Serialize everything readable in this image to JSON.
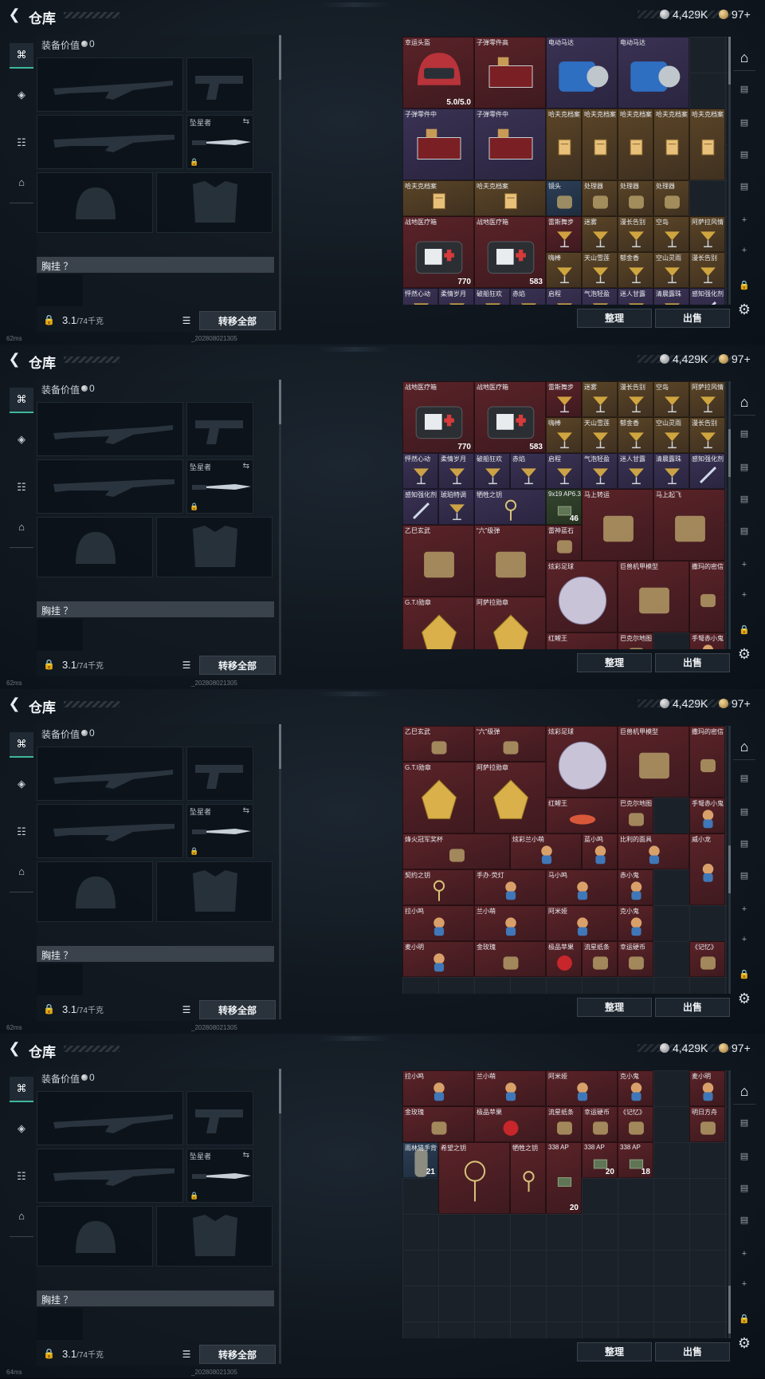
{
  "header": {
    "title": "仓库",
    "currency_silver": "4,429K",
    "currency_gold": "97+"
  },
  "equipment": {
    "value_label": "装备价值",
    "value": "0",
    "melee_name": "坠星者",
    "chest_label": "胸挂 ？",
    "weight_value": "3.1",
    "weight_max": "/74千克",
    "transfer_all": "转移全部"
  },
  "inventory": {
    "sort_button": "整理",
    "sell_button": "出售"
  },
  "right_rail": {
    "tabs": [
      "warehouse-icon",
      "crate-icon",
      "bag-icon",
      "bag-icon",
      "bag-icon",
      "plus-icon",
      "plus-icon",
      "lock-icon",
      "gear-icon"
    ]
  },
  "status": {
    "ping": [
      "62ms",
      "62ms",
      "62ms",
      "64ms"
    ],
    "build": "_202808021305"
  },
  "frames": [
    {
      "items": [
        {
          "name": "幸运头盔",
          "count": "5.0/5.0",
          "rarity": "red",
          "icon": "helmet-icon"
        },
        {
          "name": "子弹零件高",
          "count": "",
          "rarity": "red",
          "icon": "parts-icon"
        },
        {
          "name": "电动马达",
          "count": "",
          "rarity": "purple",
          "icon": "motor-icon"
        },
        {
          "name": "电动马达",
          "count": "",
          "rarity": "purple",
          "icon": "motor-icon"
        },
        {
          "name": "子弹零件中",
          "count": "",
          "rarity": "purple",
          "icon": "parts-icon"
        },
        {
          "name": "子弹零件中",
          "count": "",
          "rarity": "purple",
          "icon": "parts-icon"
        },
        {
          "name": "哈夫克档案",
          "count": "",
          "rarity": "gold",
          "icon": "file-icon"
        },
        {
          "name": "哈夫克档案",
          "count": "",
          "rarity": "gold",
          "icon": "file-icon"
        },
        {
          "name": "哈夫克档案",
          "count": "",
          "rarity": "gold",
          "icon": "file-icon"
        },
        {
          "name": "哈夫克档案",
          "count": "",
          "rarity": "gold",
          "icon": "file-icon"
        },
        {
          "name": "哈夫克档案",
          "count": "",
          "rarity": "gold",
          "icon": "file-icon"
        },
        {
          "name": "哈夫克档案",
          "count": "",
          "rarity": "gold",
          "icon": "file-icon"
        },
        {
          "name": "哈夫克档案",
          "count": "",
          "rarity": "gold",
          "icon": "file-icon"
        },
        {
          "name": "镜头",
          "count": "",
          "rarity": "blue",
          "icon": "lens-icon"
        },
        {
          "name": "处理器",
          "count": "",
          "rarity": "gold",
          "icon": "chip-icon"
        },
        {
          "name": "处理器",
          "count": "",
          "rarity": "gold",
          "icon": "chip-icon"
        },
        {
          "name": "处理器",
          "count": "",
          "rarity": "gold",
          "icon": "chip-icon"
        },
        {
          "name": "战地医疗箱",
          "count": "770",
          "rarity": "red",
          "icon": "medkit-icon"
        },
        {
          "name": "战地医疗箱",
          "count": "583",
          "rarity": "red",
          "icon": "medkit-icon"
        },
        {
          "name": "雷斯舞步",
          "count": "",
          "rarity": "red",
          "icon": "cocktail-icon"
        },
        {
          "name": "迷雾",
          "count": "",
          "rarity": "gold",
          "icon": "cocktail-icon"
        },
        {
          "name": "漫长告别",
          "count": "",
          "rarity": "gold",
          "icon": "cocktail-icon"
        },
        {
          "name": "空岛",
          "count": "",
          "rarity": "gold",
          "icon": "cocktail-icon"
        },
        {
          "name": "阿萨拉风情",
          "count": "",
          "rarity": "gold",
          "icon": "cocktail-icon"
        },
        {
          "name": "嗨棒",
          "count": "",
          "rarity": "gold",
          "icon": "cocktail-icon"
        },
        {
          "name": "天山雪莲",
          "count": "",
          "rarity": "gold",
          "icon": "cocktail-icon"
        },
        {
          "name": "郁金香",
          "count": "",
          "rarity": "gold",
          "icon": "cocktail-icon"
        },
        {
          "name": "空山灵雨",
          "count": "",
          "rarity": "gold",
          "icon": "cocktail-icon"
        },
        {
          "name": "漫长告别",
          "count": "",
          "rarity": "gold",
          "icon": "cocktail-icon"
        },
        {
          "name": "怦然心动",
          "count": "",
          "rarity": "purple",
          "icon": "cocktail-icon"
        },
        {
          "name": "柔情岁月",
          "count": "",
          "rarity": "purple",
          "icon": "cocktail-icon"
        },
        {
          "name": "破船狂欢",
          "count": "",
          "rarity": "purple",
          "icon": "cocktail-icon"
        },
        {
          "name": "赤焰",
          "count": "",
          "rarity": "purple",
          "icon": "cocktail-icon"
        },
        {
          "name": "启程",
          "count": "",
          "rarity": "purple",
          "icon": "cocktail-icon"
        },
        {
          "name": "气泡轻盈",
          "count": "",
          "rarity": "purple",
          "icon": "cocktail-icon"
        },
        {
          "name": "迷人甘露",
          "count": "",
          "rarity": "purple",
          "icon": "cocktail-icon"
        },
        {
          "name": "清晨露珠",
          "count": "",
          "rarity": "purple",
          "icon": "cocktail-icon"
        },
        {
          "name": "感知强化剂",
          "count": "",
          "rarity": "purple",
          "icon": "syringe-icon"
        }
      ]
    },
    {
      "items": [
        {
          "name": "战地医疗箱",
          "count": "770",
          "rarity": "red",
          "icon": "medkit-icon"
        },
        {
          "name": "战地医疗箱",
          "count": "583",
          "rarity": "red",
          "icon": "medkit-icon"
        },
        {
          "name": "雷斯舞步",
          "count": "",
          "rarity": "red",
          "icon": "cocktail-icon"
        },
        {
          "name": "迷雾",
          "count": "",
          "rarity": "gold",
          "icon": "cocktail-icon"
        },
        {
          "name": "漫长告别",
          "count": "",
          "rarity": "gold",
          "icon": "cocktail-icon"
        },
        {
          "name": "空岛",
          "count": "",
          "rarity": "gold",
          "icon": "cocktail-icon"
        },
        {
          "name": "阿萨拉风情",
          "count": "",
          "rarity": "gold",
          "icon": "cocktail-icon"
        },
        {
          "name": "嗨棒",
          "count": "",
          "rarity": "gold",
          "icon": "cocktail-icon"
        },
        {
          "name": "天山雪莲",
          "count": "",
          "rarity": "gold",
          "icon": "cocktail-icon"
        },
        {
          "name": "郁金香",
          "count": "",
          "rarity": "gold",
          "icon": "cocktail-icon"
        },
        {
          "name": "空山灵雨",
          "count": "",
          "rarity": "gold",
          "icon": "cocktail-icon"
        },
        {
          "name": "漫长告别",
          "count": "",
          "rarity": "gold",
          "icon": "cocktail-icon"
        },
        {
          "name": "怦然心动",
          "count": "",
          "rarity": "purple",
          "icon": "cocktail-icon"
        },
        {
          "name": "柔情岁月",
          "count": "",
          "rarity": "purple",
          "icon": "cocktail-icon"
        },
        {
          "name": "破船狂欢",
          "count": "",
          "rarity": "purple",
          "icon": "cocktail-icon"
        },
        {
          "name": "赤焰",
          "count": "",
          "rarity": "purple",
          "icon": "cocktail-icon"
        },
        {
          "name": "启程",
          "count": "",
          "rarity": "purple",
          "icon": "cocktail-icon"
        },
        {
          "name": "气泡轻盈",
          "count": "",
          "rarity": "purple",
          "icon": "cocktail-icon"
        },
        {
          "name": "迷人甘露",
          "count": "",
          "rarity": "purple",
          "icon": "cocktail-icon"
        },
        {
          "name": "清晨露珠",
          "count": "",
          "rarity": "purple",
          "icon": "cocktail-icon"
        },
        {
          "name": "感知强化剂",
          "count": "",
          "rarity": "purple",
          "icon": "syringe-icon"
        },
        {
          "name": "感知强化剂",
          "count": "",
          "rarity": "purple",
          "icon": "syringe-icon"
        },
        {
          "name": "琥珀特调",
          "count": "",
          "rarity": "purple",
          "icon": "cocktail-icon"
        },
        {
          "name": "牺牲之钥",
          "count": "",
          "rarity": "purple",
          "icon": "key-icon"
        },
        {
          "name": "9x19 AP6.3",
          "count": "46",
          "rarity": "green",
          "icon": "ammo-icon"
        },
        {
          "name": "马上转运",
          "count": "",
          "rarity": "red",
          "icon": "compass-icon"
        },
        {
          "name": "马上起飞",
          "count": "",
          "rarity": "red",
          "icon": "horse-icon"
        },
        {
          "name": "乙巳玄武",
          "count": "",
          "rarity": "red",
          "icon": "turtle-icon"
        },
        {
          "name": "“六”级弹",
          "count": "",
          "rarity": "red",
          "icon": "hand-icon"
        },
        {
          "name": "雷神蓝石",
          "count": "",
          "rarity": "red",
          "icon": "stone-icon"
        },
        {
          "name": "炫彩足球",
          "count": "",
          "rarity": "red",
          "icon": "ball-icon"
        },
        {
          "name": "巨兽机甲模型",
          "count": "",
          "rarity": "red",
          "icon": "mech-icon"
        },
        {
          "name": "撒玛的密信",
          "count": "",
          "rarity": "red",
          "icon": "letter-icon"
        },
        {
          "name": "G.T.I勋章",
          "count": "",
          "rarity": "red",
          "icon": "medal-icon"
        },
        {
          "name": "阿萨拉勋章",
          "count": "",
          "rarity": "red",
          "icon": "medal-icon"
        },
        {
          "name": "红鲤王",
          "count": "",
          "rarity": "red",
          "icon": "fish-icon"
        },
        {
          "name": "巴克尔地图",
          "count": "",
          "rarity": "red",
          "icon": "map-icon"
        },
        {
          "name": "手弩赤小鬼",
          "count": "",
          "rarity": "red",
          "icon": "figure-icon"
        }
      ]
    },
    {
      "items": [
        {
          "name": "乙巳玄武",
          "count": "",
          "rarity": "red",
          "icon": "turtle-icon"
        },
        {
          "name": "“六”级弹",
          "count": "",
          "rarity": "red",
          "icon": "hand-icon"
        },
        {
          "name": "炫彩足球",
          "count": "",
          "rarity": "red",
          "icon": "ball-icon"
        },
        {
          "name": "巨兽机甲模型",
          "count": "",
          "rarity": "red",
          "icon": "mech-icon"
        },
        {
          "name": "撒玛的密信",
          "count": "",
          "rarity": "red",
          "icon": "letter-icon"
        },
        {
          "name": "G.T.I勋章",
          "count": "",
          "rarity": "red",
          "icon": "medal-icon"
        },
        {
          "name": "阿萨拉勋章",
          "count": "",
          "rarity": "red",
          "icon": "medal-icon"
        },
        {
          "name": "红鲤王",
          "count": "",
          "rarity": "red",
          "icon": "fish-icon"
        },
        {
          "name": "巴克尔地图",
          "count": "",
          "rarity": "red",
          "icon": "map-icon"
        },
        {
          "name": "手弩赤小鬼",
          "count": "",
          "rarity": "red",
          "icon": "figure-icon"
        },
        {
          "name": "烽火冠军奖杯",
          "count": "",
          "rarity": "red",
          "icon": "trophy-icon"
        },
        {
          "name": "炫彩兰小萌",
          "count": "",
          "rarity": "red",
          "icon": "figure-icon"
        },
        {
          "name": "蓝小鸣",
          "count": "",
          "rarity": "red",
          "icon": "figure-icon"
        },
        {
          "name": "比利的面具",
          "count": "",
          "rarity": "red",
          "icon": "figure-icon"
        },
        {
          "name": "契约之钥",
          "count": "",
          "rarity": "red",
          "icon": "key-icon"
        },
        {
          "name": "手办·荧灯",
          "count": "",
          "rarity": "red",
          "icon": "figure-icon"
        },
        {
          "name": "马小鸣",
          "count": "",
          "rarity": "red",
          "icon": "figure-icon"
        },
        {
          "name": "赤小鬼",
          "count": "",
          "rarity": "red",
          "icon": "figure-icon"
        },
        {
          "name": "威小龙",
          "count": "",
          "rarity": "red",
          "icon": "figure-icon"
        },
        {
          "name": "拉小鸣",
          "count": "",
          "rarity": "red",
          "icon": "figure-icon"
        },
        {
          "name": "兰小萌",
          "count": "",
          "rarity": "red",
          "icon": "figure-icon"
        },
        {
          "name": "阿米娅",
          "count": "",
          "rarity": "red",
          "icon": "figure-icon"
        },
        {
          "name": "克小鬼",
          "count": "",
          "rarity": "red",
          "icon": "figure-icon"
        },
        {
          "name": "麦小明",
          "count": "",
          "rarity": "red",
          "icon": "figure-icon"
        },
        {
          "name": "金玫瑰",
          "count": "",
          "rarity": "red",
          "icon": "rose-icon"
        },
        {
          "name": "极品苹果",
          "count": "",
          "rarity": "red",
          "icon": "apple-icon"
        },
        {
          "name": "流星纸条",
          "count": "",
          "rarity": "red",
          "icon": "letter-icon"
        },
        {
          "name": "幸运硬币",
          "count": "",
          "rarity": "red",
          "icon": "moon-icon"
        },
        {
          "name": "《记忆》",
          "count": "",
          "rarity": "red",
          "icon": "book-icon"
        }
      ]
    },
    {
      "items": [
        {
          "name": "拉小鸣",
          "count": "",
          "rarity": "red",
          "icon": "figure-icon"
        },
        {
          "name": "兰小萌",
          "count": "",
          "rarity": "red",
          "icon": "figure-icon"
        },
        {
          "name": "阿米娅",
          "count": "",
          "rarity": "red",
          "icon": "figure-icon"
        },
        {
          "name": "克小鬼",
          "count": "",
          "rarity": "red",
          "icon": "figure-icon"
        },
        {
          "name": "麦小明",
          "count": "",
          "rarity": "red",
          "icon": "figure-icon"
        },
        {
          "name": "金玫瑰",
          "count": "",
          "rarity": "red",
          "icon": "rose-icon"
        },
        {
          "name": "极品苹果",
          "count": "",
          "rarity": "red",
          "icon": "apple-icon"
        },
        {
          "name": "流星纸条",
          "count": "",
          "rarity": "red",
          "icon": "letter-icon"
        },
        {
          "name": "幸运硬币",
          "count": "",
          "rarity": "red",
          "icon": "moon-icon"
        },
        {
          "name": "《记忆》",
          "count": "",
          "rarity": "red",
          "icon": "book-icon"
        },
        {
          "name": "明日方舟",
          "count": "",
          "rarity": "red",
          "icon": "book-icon"
        },
        {
          "name": "雨林猎手背包 三角洲",
          "count": "21",
          "rarity": "blue",
          "icon": "backpack-icon"
        },
        {
          "name": "希望之钥",
          "count": "",
          "rarity": "red",
          "icon": "key-icon"
        },
        {
          "name": "牺牲之钥",
          "count": "",
          "rarity": "red",
          "icon": "key-icon"
        },
        {
          "name": "338 AP",
          "count": "20",
          "rarity": "red",
          "icon": "ammo-icon"
        },
        {
          "name": "338 AP",
          "count": "20",
          "rarity": "red",
          "icon": "ammo-icon"
        },
        {
          "name": "338 AP",
          "count": "18",
          "rarity": "red",
          "icon": "ammo-icon"
        }
      ]
    }
  ],
  "colors": {
    "accent": "#3fb79b",
    "red_rarity": "#5a2328",
    "gold_rarity": "#5b4527",
    "purple_rarity": "#3a3253",
    "blue_rarity": "#2c3f56"
  }
}
